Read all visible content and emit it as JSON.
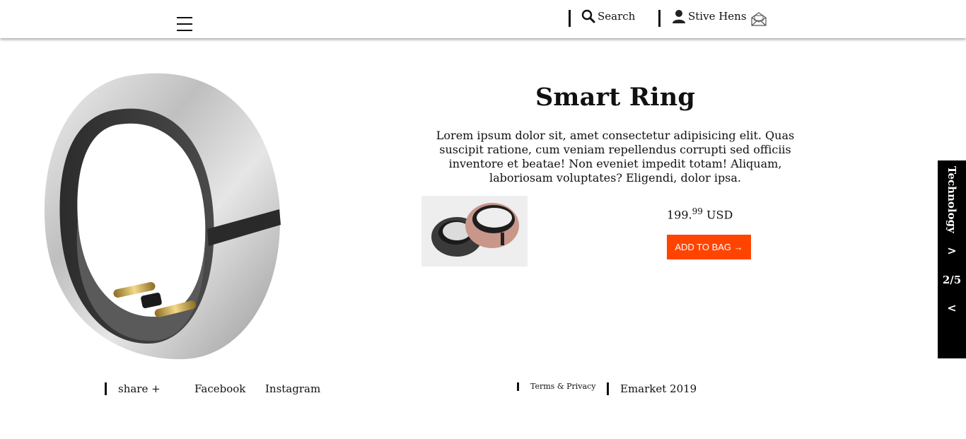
{
  "header": {
    "search_label": "Search",
    "user_name": "Stive Hens"
  },
  "product": {
    "title": "Smart Ring",
    "description": "Lorem ipsum dolor sit, amet consectetur adipisicing elit. Quas suscipit ratione, cum veniam repellendus corrupti sed officiis inventore et beatae! Non eveniet impedit totam! Aliquam, laboriosam voluptates? Eligendi, dolor ipsa.",
    "price_main": "199.",
    "price_cents": "99",
    "price_currency": "USD",
    "add_button_label": "ADD TO BAG →"
  },
  "side_rail": {
    "category": "Technology",
    "next": ">",
    "page": "2/5",
    "prev": "<"
  },
  "footer": {
    "share": "share +",
    "facebook": "Facebook",
    "instagram": "Instagram",
    "terms": "Terms & Privacy",
    "copyright": "Emarket 2019"
  },
  "colors": {
    "accent": "#ff4400",
    "rail_bg": "#000000"
  }
}
